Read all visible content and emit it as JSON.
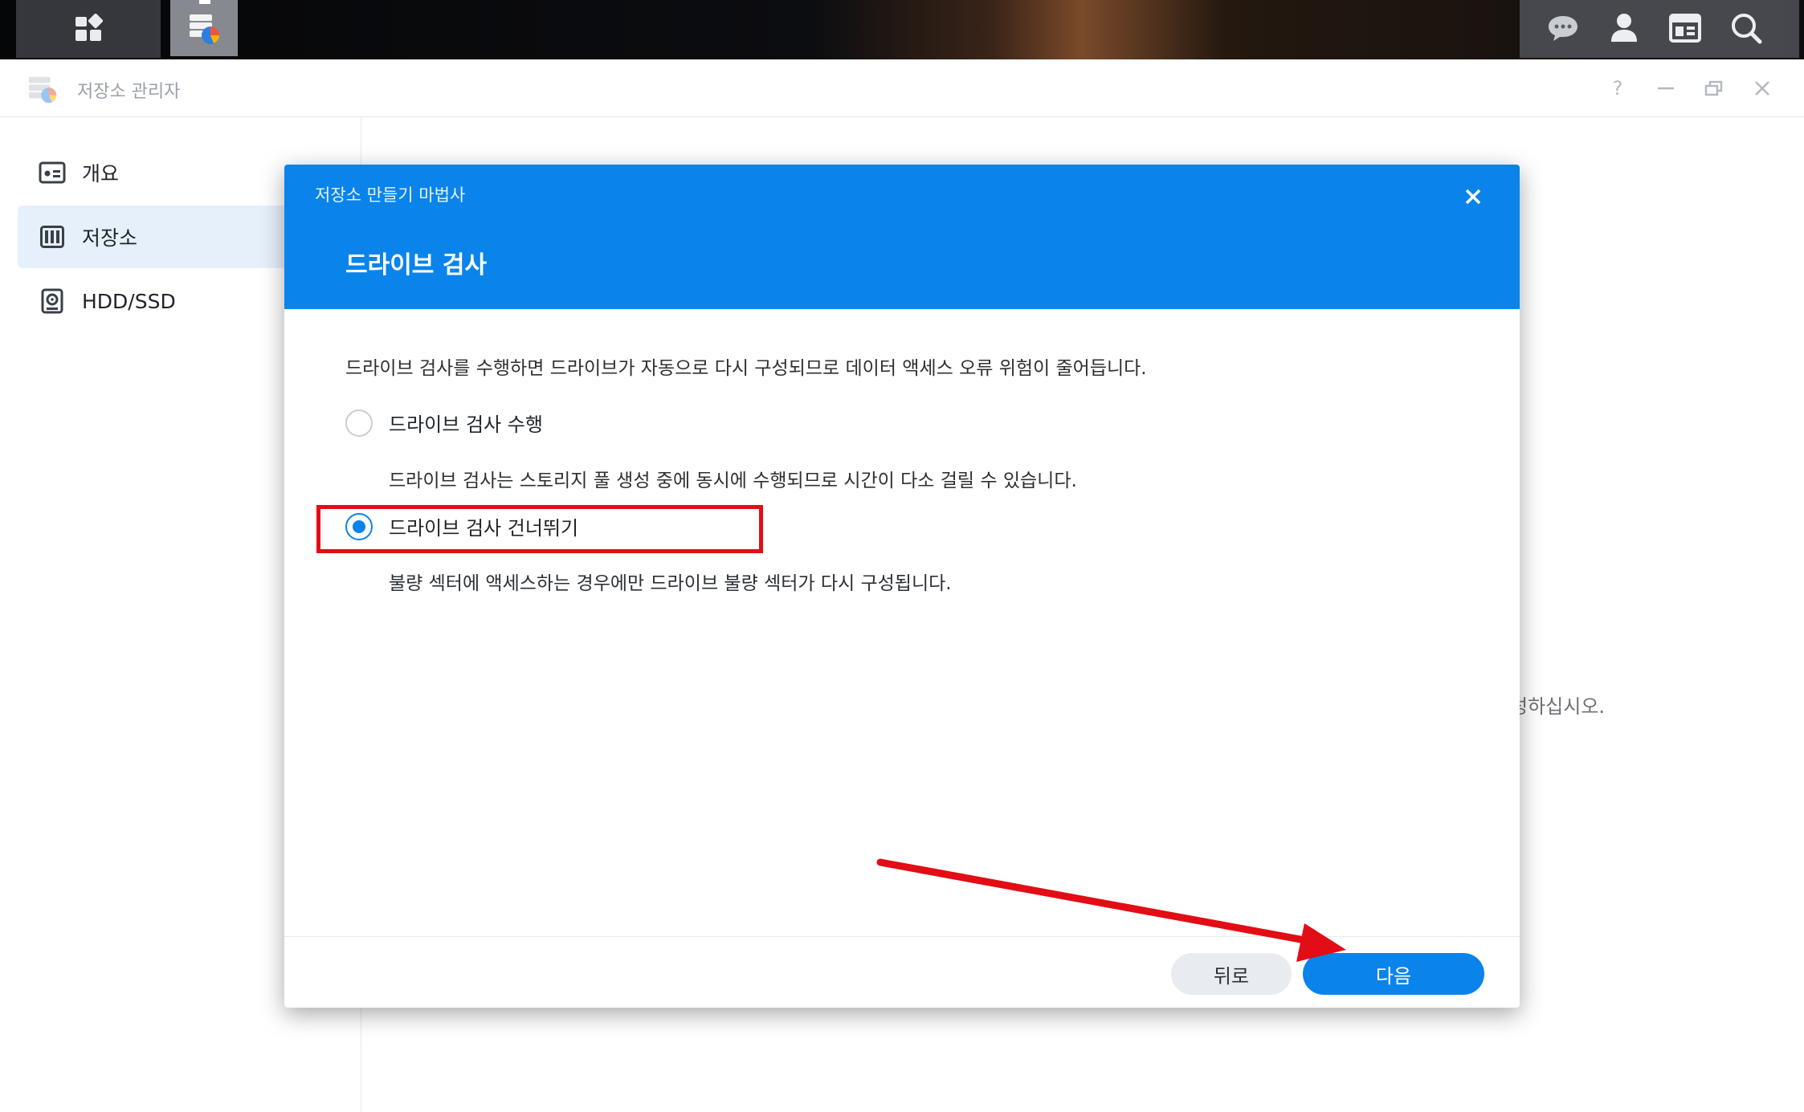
{
  "taskbar": {
    "main_menu_icon": "grid-icon",
    "storage_app_icon": "storage-manager-icon",
    "right_icons": [
      "chat-icon",
      "user-icon",
      "widgets-icon",
      "search-icon"
    ]
  },
  "window": {
    "title": "저장소 관리자",
    "controls": [
      "?",
      "—",
      "restore",
      "×"
    ]
  },
  "sidebar": {
    "items": [
      {
        "label": "개요",
        "icon": "overview-icon",
        "active": false
      },
      {
        "label": "저장소",
        "icon": "storage-icon",
        "active": true
      },
      {
        "label": "HDD/SSD",
        "icon": "hdd-icon",
        "active": false
      }
    ]
  },
  "background_text": "성하십시오.",
  "dialog": {
    "wizard_title": "저장소 만들기 마법사",
    "step_title": "드라이브 검사",
    "description": "드라이브 검사를 수행하면 드라이브가 자동으로 다시 구성되므로 데이터 액세스 오류 위험이 줄어듭니다.",
    "options": [
      {
        "label": "드라이브 검사 수행",
        "description": "드라이브 검사는 스토리지 풀 생성 중에 동시에 수행되므로 시간이 다소 걸릴 수 있습니다.",
        "selected": false
      },
      {
        "label": "드라이브 검사 건너뛰기",
        "description": "불량 섹터에 액세스하는 경우에만 드라이브 불량 섹터가 다시 구성됩니다.",
        "selected": true
      }
    ],
    "back_label": "뒤로",
    "next_label": "다음"
  },
  "colors": {
    "accent": "#0a84ea",
    "annotation": "#e20d15"
  }
}
